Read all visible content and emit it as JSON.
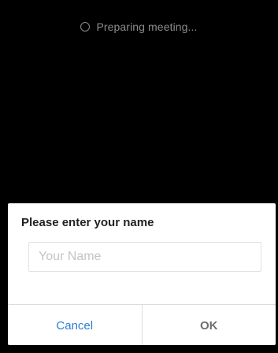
{
  "status": {
    "icon": "loading-spinner-icon",
    "text": "Preparing meeting..."
  },
  "dialog": {
    "title": "Please enter your name",
    "input": {
      "value": "",
      "placeholder": "Your Name"
    },
    "buttons": {
      "cancel": "Cancel",
      "ok": "OK"
    }
  },
  "colors": {
    "background": "#000000",
    "dialog_background": "#ffffff",
    "cancel_text": "#2b7fd6",
    "ok_text": "#6e6e6e",
    "status_text": "#8c8c8c"
  }
}
